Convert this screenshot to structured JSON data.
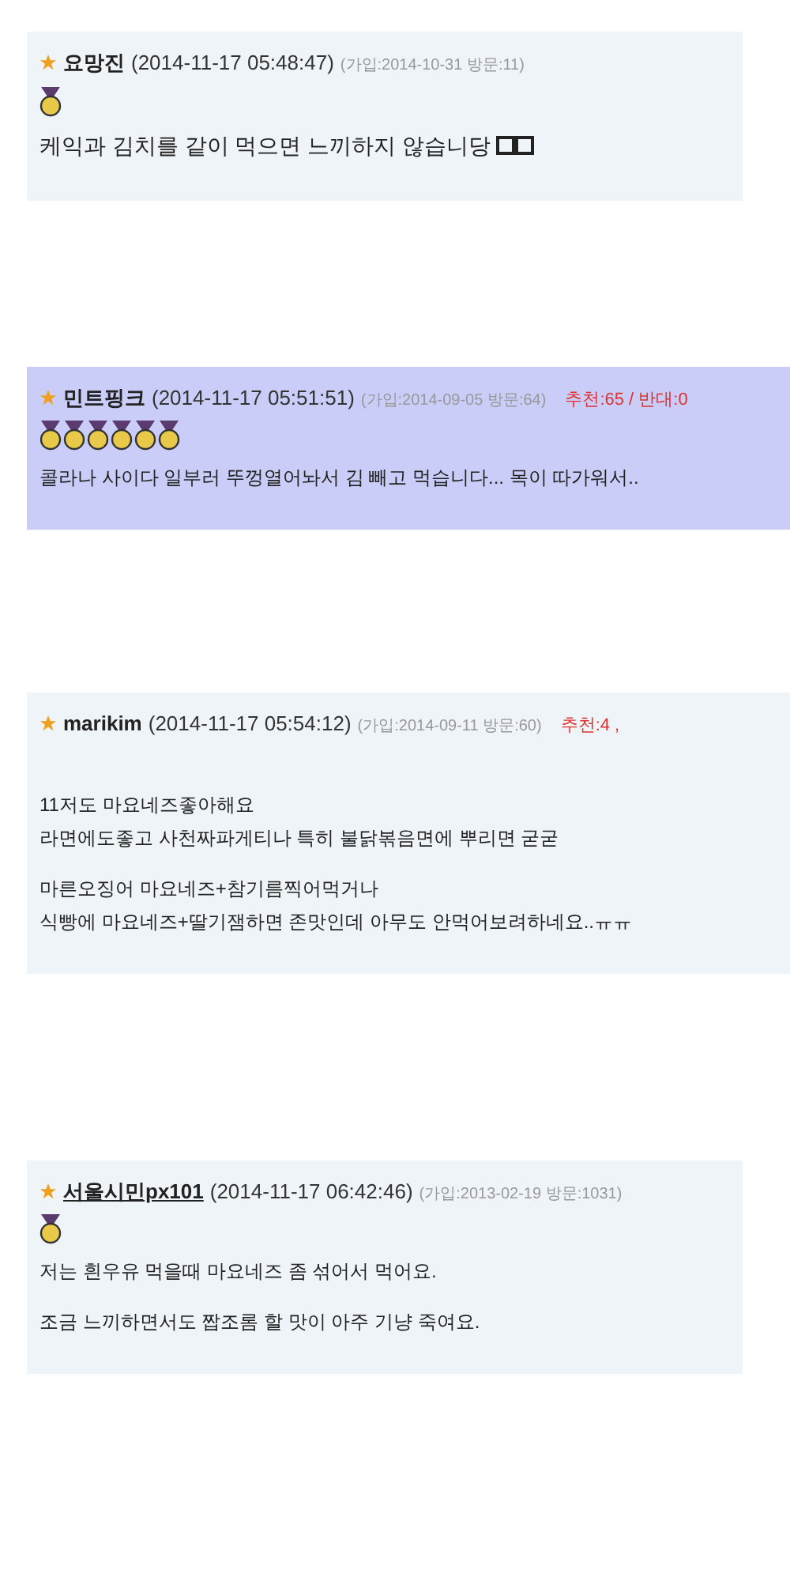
{
  "comments": [
    {
      "author": "요망진",
      "linked": false,
      "timestamp": "(2014-11-17 05:48:47)",
      "meta": "(가입:2014-10-31 방문:11)",
      "highlighted": false,
      "large": true,
      "medals": [
        {
          "kind": "gold"
        }
      ],
      "emoticon": true,
      "paragraphs": [
        [
          "케익과 김치를 같이 먹으면 느끼하지 않습니당"
        ]
      ]
    },
    {
      "author": "민트핑크",
      "linked": false,
      "timestamp": "(2014-11-17 05:51:51)",
      "meta": "(가입:2014-09-05 방문:64)",
      "votes": "추천:65 / 반대:0",
      "highlighted": true,
      "large": false,
      "medals": [
        {
          "kind": "gold"
        },
        {
          "kind": "gold"
        },
        {
          "kind": "gold"
        },
        {
          "kind": "gold"
        },
        {
          "kind": "gold"
        },
        {
          "kind": "gold"
        }
      ],
      "emoticon": false,
      "paragraphs": [
        [
          "콜라나 사이다 일부러 뚜껑열어놔서 김 빼고 먹습니다... 목이 따가워서.."
        ]
      ]
    },
    {
      "author": "marikim",
      "linked": false,
      "timestamp": "(2014-11-17 05:54:12)",
      "meta": "(가입:2014-09-11 방문:60)",
      "votes": "추천:4 ,",
      "highlighted": false,
      "large": false,
      "emoticon": false,
      "paragraphs": [
        [
          "11저도 마요네즈좋아해요",
          "라면에도좋고 사천짜파게티나 특히 불닭볶음면에 뿌리면 굳굳"
        ],
        [
          "마른오징어 마요네즈+참기름찍어먹거나",
          "식빵에 마요네즈+딸기잼하면 존맛인데 아무도 안먹어보려하네요..ㅠㅠ"
        ]
      ]
    },
    {
      "author": "서울시민px101",
      "linked": true,
      "timestamp": "(2014-11-17 06:42:46)",
      "meta": "(가입:2013-02-19 방문:1031)",
      "highlighted": false,
      "large": false,
      "medals": [
        {
          "kind": "gold"
        }
      ],
      "emoticon": false,
      "paragraphs": [
        [
          "저는 흰우유 먹을때 마요네즈 좀 섞어서 먹어요."
        ],
        [
          "조금 느끼하면서도 짭조롬 할 맛이 아주 기냥 죽여요."
        ]
      ]
    }
  ]
}
